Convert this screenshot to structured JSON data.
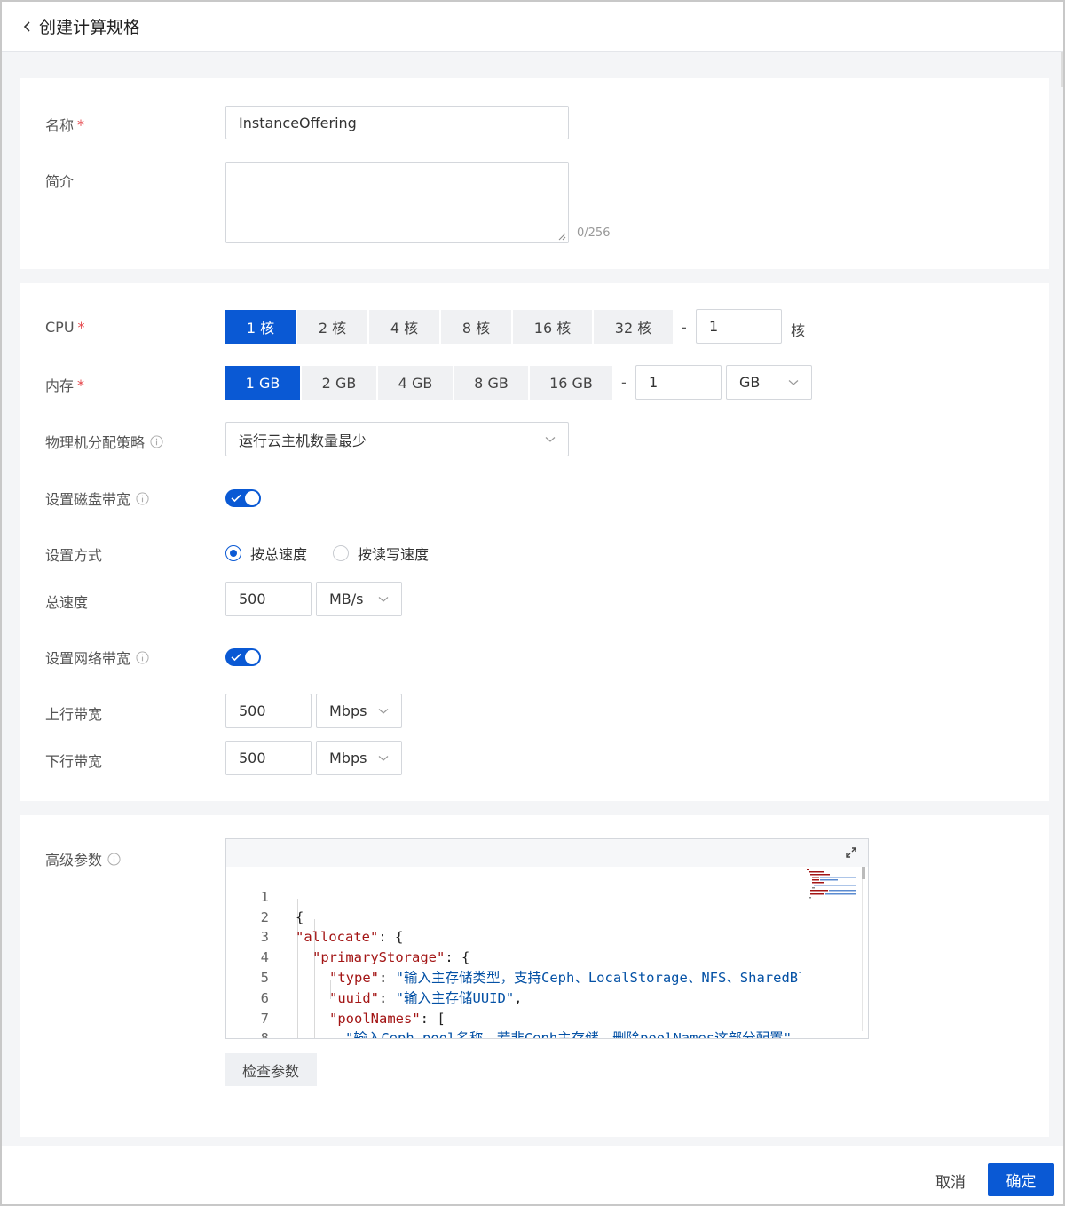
{
  "header": {
    "title": "创建计算规格"
  },
  "basic": {
    "name_label": "名称",
    "required_mark": "*",
    "name_value": "InstanceOffering",
    "desc_label": "简介",
    "desc_value": "",
    "desc_counter": "0/256"
  },
  "spec": {
    "cpu_label": "CPU",
    "cpu_options": [
      "1 核",
      "2 核",
      "4 核",
      "8 核",
      "16 核",
      "32 核"
    ],
    "cpu_selected": "1 核",
    "dash": "-",
    "cpu_custom_value": "1",
    "cpu_unit": "核",
    "memory_label": "内存",
    "memory_options": [
      "1 GB",
      "2 GB",
      "4 GB",
      "8 GB",
      "16 GB"
    ],
    "memory_selected": "1 GB",
    "memory_custom_value": "1",
    "memory_unit": "GB",
    "host_strategy_label": "物理机分配策略",
    "host_strategy_value": "运行云主机数量最少",
    "disk_bw_label": "设置磁盘带宽",
    "disk_bw_enabled": true,
    "mode_label": "设置方式",
    "mode_options": [
      "按总速度",
      "按读写速度"
    ],
    "mode_selected": "按总速度",
    "total_speed_label": "总速度",
    "total_speed_value": "500",
    "total_speed_unit": "MB/s",
    "net_bw_label": "设置网络带宽",
    "net_bw_enabled": true,
    "upload_label": "上行带宽",
    "upload_value": "500",
    "upload_unit": "Mbps",
    "download_label": "下行带宽",
    "download_value": "500",
    "download_unit": "Mbps"
  },
  "advanced": {
    "label": "高级参数",
    "line_numbers": [
      "1",
      "2",
      "3",
      "4",
      "5",
      "6",
      "7",
      "8"
    ],
    "check_button": "检查参数",
    "code": {
      "l1": "{",
      "l2_key": "\"allocate\"",
      "l2_rest": ": {",
      "l3_key": "\"primaryStorage\"",
      "l3_rest": ": {",
      "l4_key": "\"type\"",
      "l4_sep": ": ",
      "l4_val": "\"输入主存储类型，支持Ceph、LocalStorage、NFS、SharedBlock\",",
      "l5_key": "\"uuid\"",
      "l5_sep": ": ",
      "l5_val": "\"输入主存储UUID\"",
      "l5_end": ",",
      "l6_key": "\"poolNames\"",
      "l6_rest": ": [",
      "l7_val": "\"输入Ceph pool名称，若非Ceph主存储，删除poolNames这部分配置\"",
      "l8": "]"
    }
  },
  "footer": {
    "cancel": "取消",
    "confirm": "确定"
  },
  "colors": {
    "primary": "#0a59d4",
    "required": "#e5484d",
    "json_key": "#a31515",
    "json_string": "#0451a5"
  }
}
